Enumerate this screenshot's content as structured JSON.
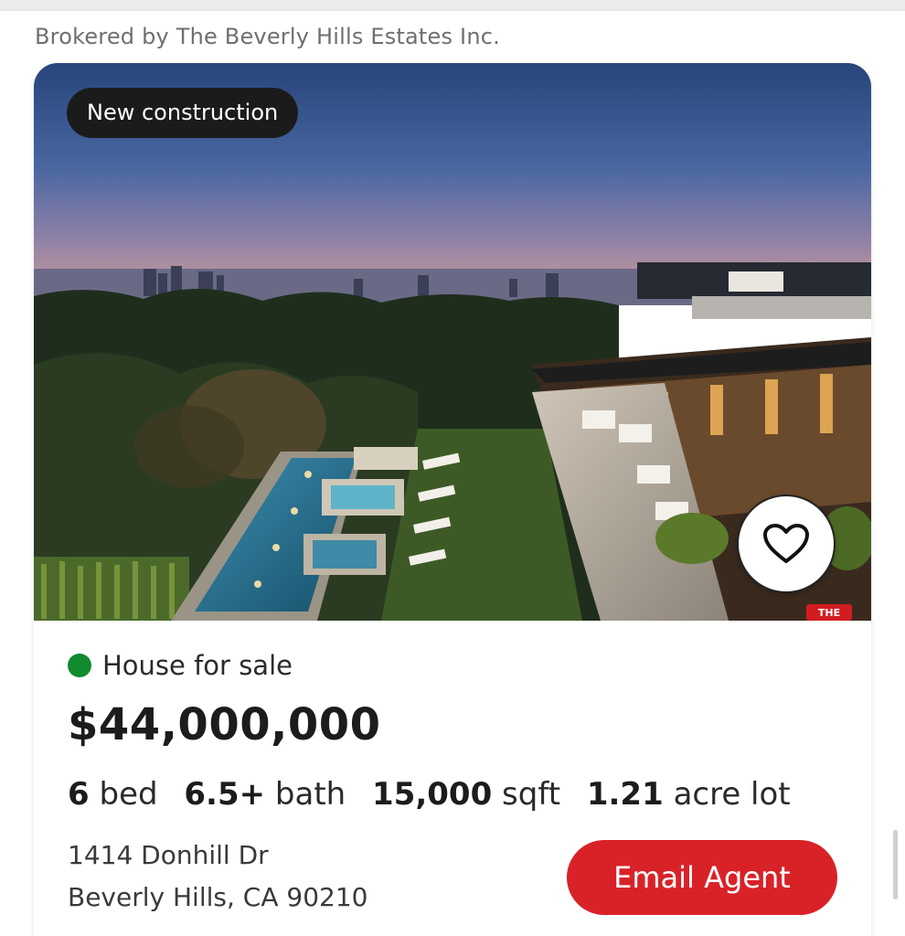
{
  "brokered": "Brokered by The Beverly Hills Estates Inc.",
  "listing": {
    "badge": "New construction",
    "status": "House for sale",
    "price": "$44,000,000",
    "specs": [
      {
        "value": "6",
        "unit": "bed"
      },
      {
        "value": "6.5+",
        "unit": "bath"
      },
      {
        "value": "15,000",
        "unit": "sqft"
      },
      {
        "value": "1.21",
        "unit": "acre lot"
      }
    ],
    "address_line1": "1414 Donhill Dr",
    "address_line2": "Beverly Hills, CA 90210",
    "cta": "Email Agent",
    "favorite_icon": "heart-outline-icon"
  },
  "colors": {
    "accent": "#d92228",
    "status_dot": "#128a2e",
    "badge_bg": "#1c1b1b"
  }
}
